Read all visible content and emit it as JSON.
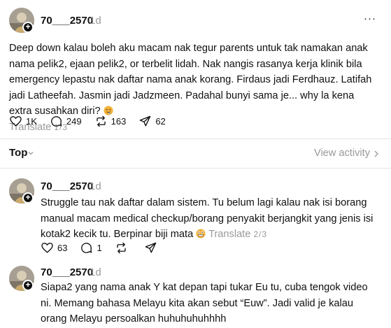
{
  "posts": [
    {
      "username": "70___2570",
      "time": "1d",
      "text": "Deep down kalau boleh aku macam nak tegur parents untuk tak namakan anak nama pelik2, ejaan pelik2, or terbelit lidah. Nak nangis rasanya kerja klinik bila emergency lepastu nak daftar nama anak korang. Firdaus jadi Ferdhauz. Latifah jadi Latheefah. Jasmin jadi Jadzmeen. Padahal bunyi sama je... why la kena extra susahkan diri?",
      "translate": "Translate",
      "translate_page": "1/3",
      "likes": "1K",
      "comments": "249",
      "reposts": "163",
      "shares": "62",
      "emoji": "drooling-face-emoji"
    },
    {
      "username": "70___2570",
      "time": "1d",
      "text": "Struggle tau nak daftar dalam sistem. Tu belum lagi kalau nak isi borang manual macam medical checkup/borang penyakit berjangkit yang jenis isi kotak2 kecik tu. Berpinar biji mata",
      "translate": "Translate",
      "translate_page": "2/3",
      "likes": "63",
      "comments": "1",
      "emoji": "grimacing-face-emoji"
    },
    {
      "username": "70___2570",
      "time": "1d",
      "text": "Siapa2 yang nama anak Y kat depan tapi tukar Eu tu, cuba tengok video ni. Memang bahasa Melayu kita akan sebut “Euw”. Jadi valid je kalau orang Melayu persoalkan huhuhuhuhhhh"
    }
  ],
  "sort": {
    "label": "Top"
  },
  "view_activity": "View activity",
  "colors": {
    "text": "#101010",
    "muted": "#999999",
    "divider": "#e5e5e5",
    "emoji": "#f2b13b"
  }
}
